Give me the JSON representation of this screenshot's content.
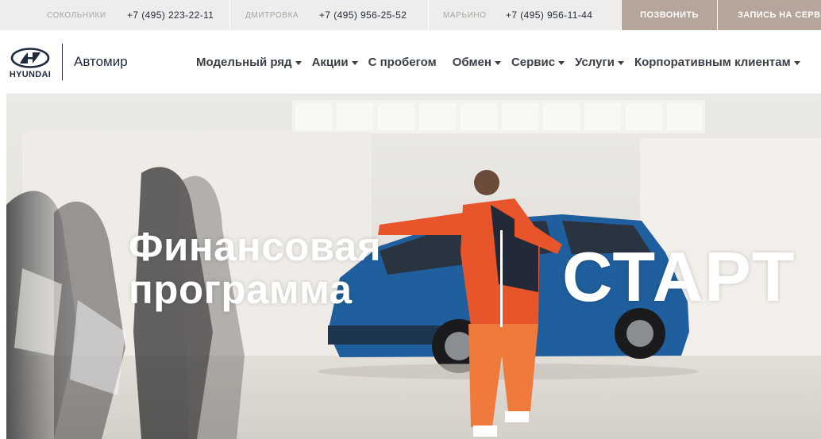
{
  "topbar": {
    "branches": [
      {
        "name": "СОКОЛЬНИКИ",
        "phone": "+7 (495) 223-22-11"
      },
      {
        "name": "ДМИТРОВКА",
        "phone": "+7 (495) 956-25-52"
      },
      {
        "name": "МАРЬИНО",
        "phone": "+7 (495) 956-11-44"
      }
    ],
    "call_button": "ПОЗВОНИТЬ",
    "service_button": "ЗАПИСЬ НА СЕРВИС"
  },
  "header": {
    "brand": "HYUNDAI",
    "dealer": "Автомир",
    "nav": [
      {
        "label": "Модельный ряд",
        "dropdown": true
      },
      {
        "label": "Акции",
        "dropdown": true
      },
      {
        "label": "С пробегом",
        "dropdown": false
      },
      {
        "label": "Обмен",
        "dropdown": true
      },
      {
        "label": "Сервис",
        "dropdown": true
      },
      {
        "label": "Услуги",
        "dropdown": true
      },
      {
        "label": "Корпоративным клиентам",
        "dropdown": true
      }
    ]
  },
  "hero": {
    "line1": "Финансовая",
    "line2": "программа",
    "program": "СТАРТ"
  },
  "colors": {
    "topbar_bg": "#efedeb",
    "accent_button": "#b6a59a",
    "text_dark": "#1f2a3c",
    "nav_text": "#3a3f47",
    "car_blue": "#1f5f9e",
    "outfit_orange": "#e8552a"
  }
}
